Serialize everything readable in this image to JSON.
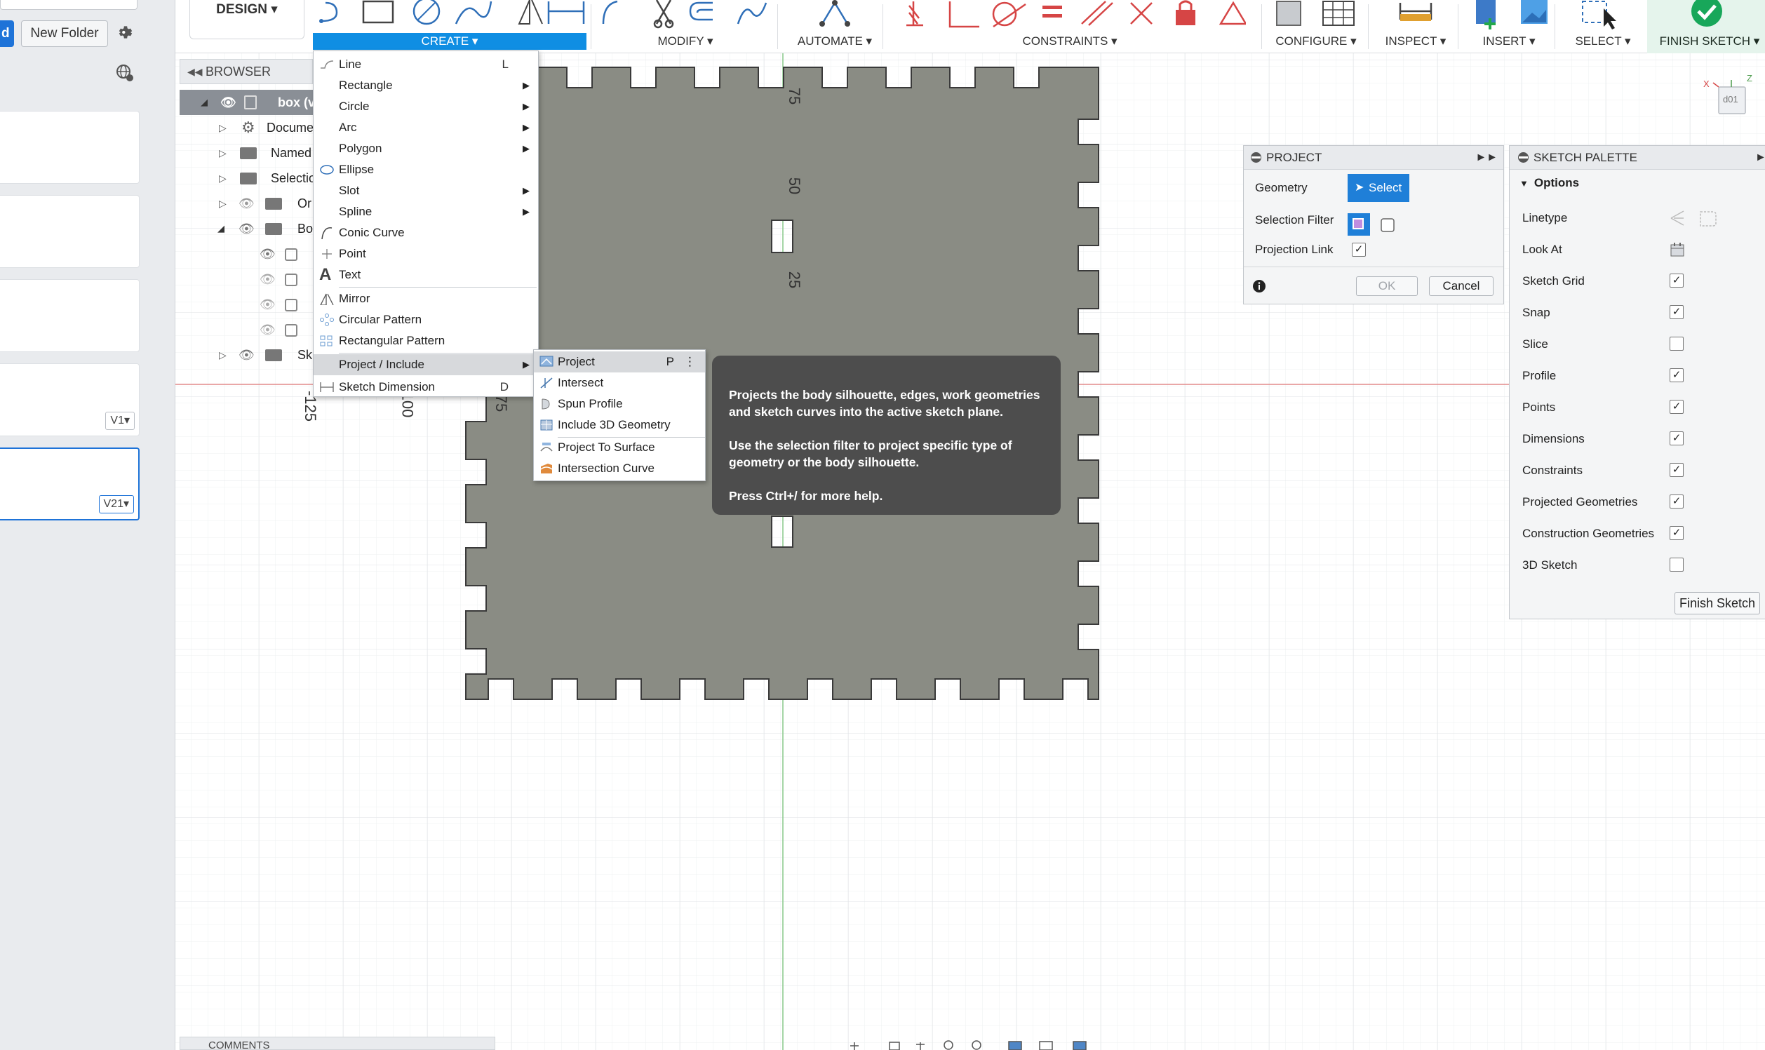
{
  "left_panel": {
    "blue_button_label": "d",
    "new_folder_label": "New Folder",
    "versions": [
      "V1▾",
      "V21▾"
    ]
  },
  "toolbar": {
    "workspace": "DESIGN ▾",
    "groups": {
      "create": "CREATE ▾",
      "modify": "MODIFY ▾",
      "automate": "AUTOMATE ▾",
      "constraints": "CONSTRAINTS ▾",
      "configure": "CONFIGURE ▾",
      "inspect": "INSPECT ▾",
      "insert": "INSERT ▾",
      "select": "SELECT ▾",
      "finish_sketch": "FINISH SKETCH ▾"
    }
  },
  "browser": {
    "title": "BROWSER",
    "rows": [
      "box (v",
      "Docume",
      "Named",
      "Selectio",
      "Or",
      "Bo",
      "Sk"
    ]
  },
  "create_menu": {
    "items": [
      {
        "label": "Line",
        "key": "L"
      },
      {
        "label": "Rectangle"
      },
      {
        "label": "Circle"
      },
      {
        "label": "Arc"
      },
      {
        "label": "Polygon"
      },
      {
        "label": "Ellipse"
      },
      {
        "label": "Slot"
      },
      {
        "label": "Spline"
      },
      {
        "label": "Conic Curve"
      },
      {
        "label": "Point"
      },
      {
        "label": "Text"
      },
      {
        "label": "Mirror"
      },
      {
        "label": "Circular Pattern"
      },
      {
        "label": "Rectangular Pattern"
      },
      {
        "label": "Project / Include"
      },
      {
        "label": "Sketch Dimension",
        "key": "D"
      }
    ]
  },
  "project_submenu": {
    "items": [
      {
        "label": "Project",
        "key": "P"
      },
      {
        "label": "Intersect"
      },
      {
        "label": "Spun Profile"
      },
      {
        "label": "Include 3D Geometry"
      },
      {
        "label": "Project To Surface"
      },
      {
        "label": "Intersection Curve"
      }
    ]
  },
  "tooltip": {
    "p1": "Projects the body silhouette, edges, work geometries and sketch curves into the active sketch plane.",
    "p2": "Use the selection filter to project specific type of geometry or the body silhouette.",
    "p3": "Press Ctrl+/ for more help."
  },
  "project_panel": {
    "title": "PROJECT",
    "geometry_label": "Geometry",
    "select_label": "Select",
    "filter_label": "Selection Filter",
    "link_label": "Projection Link",
    "link_checked": true,
    "ok_label": "OK",
    "cancel_label": "Cancel"
  },
  "sketch_palette": {
    "title": "SKETCH PALETTE",
    "section": "Options",
    "linetype_label": "Linetype",
    "lookat_label": "Look At",
    "options": [
      {
        "label": "Sketch Grid",
        "checked": true
      },
      {
        "label": "Snap",
        "checked": true
      },
      {
        "label": "Slice",
        "checked": false
      },
      {
        "label": "Profile",
        "checked": true
      },
      {
        "label": "Points",
        "checked": true
      },
      {
        "label": "Dimensions",
        "checked": true
      },
      {
        "label": "Constraints",
        "checked": true
      },
      {
        "label": "Projected Geometries",
        "checked": true
      },
      {
        "label": "Construction Geometries",
        "checked": true
      },
      {
        "label": "3D Sketch",
        "checked": false
      }
    ],
    "finish_label": "Finish Sketch"
  },
  "canvas": {
    "dim_labels": [
      "75",
      "50",
      "25",
      "-125",
      "100",
      "75"
    ]
  },
  "viewcube": {
    "face_label": "d01",
    "axis_x": "X",
    "axis_z": "Z"
  },
  "bottom": {
    "comments_label": "COMMENTS"
  },
  "colors": {
    "accent_blue": "#0f8ee3",
    "finish_green": "#18a75a",
    "sketch_body": "#8a8c84",
    "constraint_red": "#d64545"
  }
}
